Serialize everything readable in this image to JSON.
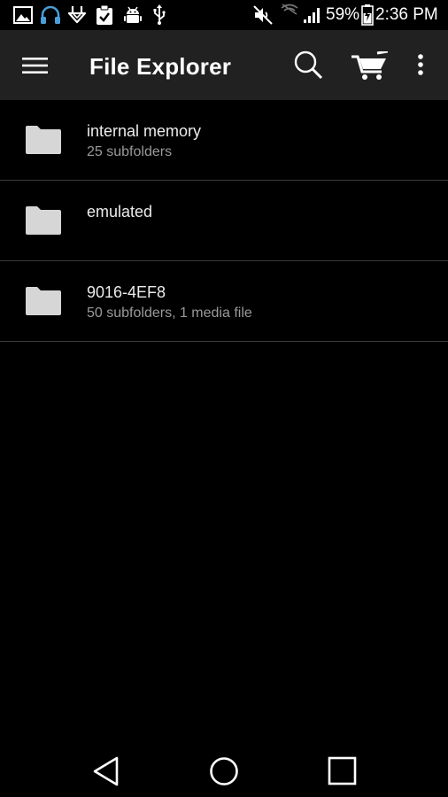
{
  "status_bar": {
    "battery_percent": "59%",
    "time": "2:36 PM",
    "icons": [
      "gallery-icon",
      "headset-icon",
      "download-icon",
      "clipboard-check-icon",
      "android-debug-icon",
      "usb-icon",
      "mute-icon",
      "no-wifi-icon",
      "signal-icon",
      "battery-icon"
    ]
  },
  "app_bar": {
    "title": "File Explorer",
    "icons": [
      "menu-icon",
      "search-icon",
      "cart-icon",
      "overflow-menu-icon"
    ]
  },
  "folders": [
    {
      "name": "internal memory",
      "detail": "25 subfolders"
    },
    {
      "name": "emulated",
      "detail": ""
    },
    {
      "name": "9016-4EF8",
      "detail": "50 subfolders, 1 media file"
    }
  ],
  "nav_bar": {
    "icons": [
      "back-icon",
      "home-icon",
      "recents-icon"
    ]
  },
  "colors": {
    "background": "#000000",
    "app_bar": "#212121",
    "folder_icon": "#d6d6d6",
    "headset_accent": "#4a9fd8",
    "primary_text": "#ececec",
    "secondary_text": "#9a9a9a",
    "divider": "#3a3a3a"
  }
}
